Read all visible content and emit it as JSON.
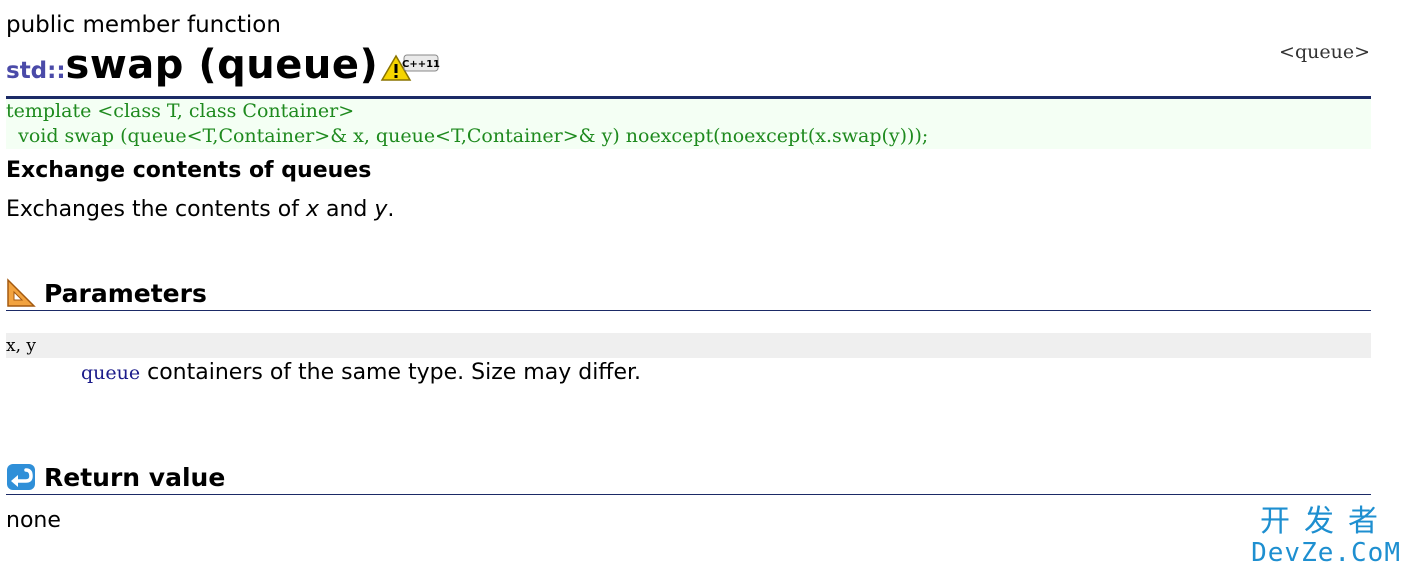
{
  "page": {
    "kind": "public member function",
    "namespace": "std::",
    "function_name": "swap (queue)",
    "badge_text": "C++11",
    "header_link": "<queue>"
  },
  "prototype": {
    "line1": "template <class T, class Container>",
    "line2": "  void swap (queue<T,Container>& x, queue<T,Container>& y) noexcept(noexcept(x.swap(y)));"
  },
  "summary": {
    "heading": "Exchange contents of queues",
    "desc_before": "Exchanges the contents of ",
    "desc_x": "x",
    "desc_and": " and ",
    "desc_y": "y",
    "desc_after": "."
  },
  "parameters": {
    "heading": "Parameters",
    "name": "x, y",
    "type_word": "queue",
    "description": " containers of the same type. Size may differ."
  },
  "return_value": {
    "heading": "Return value",
    "text": "none"
  },
  "watermark": {
    "cn": "开发者",
    "en": "DevZe.CoM"
  }
}
